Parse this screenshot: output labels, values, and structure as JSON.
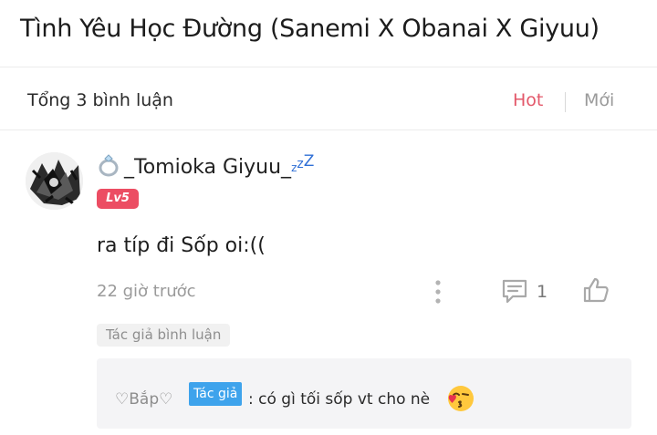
{
  "header": {
    "title": "Tình Yêu Học Đường (Sanemi X Obanai X Giyuu)"
  },
  "comments_bar": {
    "total_label": "Tổng 3 bình luận",
    "sort_hot": "Hot",
    "sort_new": "Mới"
  },
  "comment": {
    "username": "_Tomioka Giyuu_",
    "username_suffix": [
      "z",
      "z",
      "Z"
    ],
    "level": "Lv5",
    "text": "ra típ đi Sốp oi:((",
    "time": "22 giờ trước",
    "reply_count": "1",
    "author_reply_tag": "Tác giả bình luận",
    "reply": {
      "author": "♡Bắp♡",
      "badge": "Tác giả",
      "text": ": có gì tối sốp vt cho nè"
    }
  },
  "colors": {
    "accent_hot": "#e3586a",
    "level_badge": "#ec4d63",
    "author_badge": "#3ea3ec",
    "zzz": "#2f6fd6"
  },
  "icons": {
    "ring": "ring-icon",
    "more": "more-vertical-icon",
    "reply": "comment-bubble-icon",
    "like": "thumbs-up-icon",
    "emoji": "kissing-face-icon"
  }
}
